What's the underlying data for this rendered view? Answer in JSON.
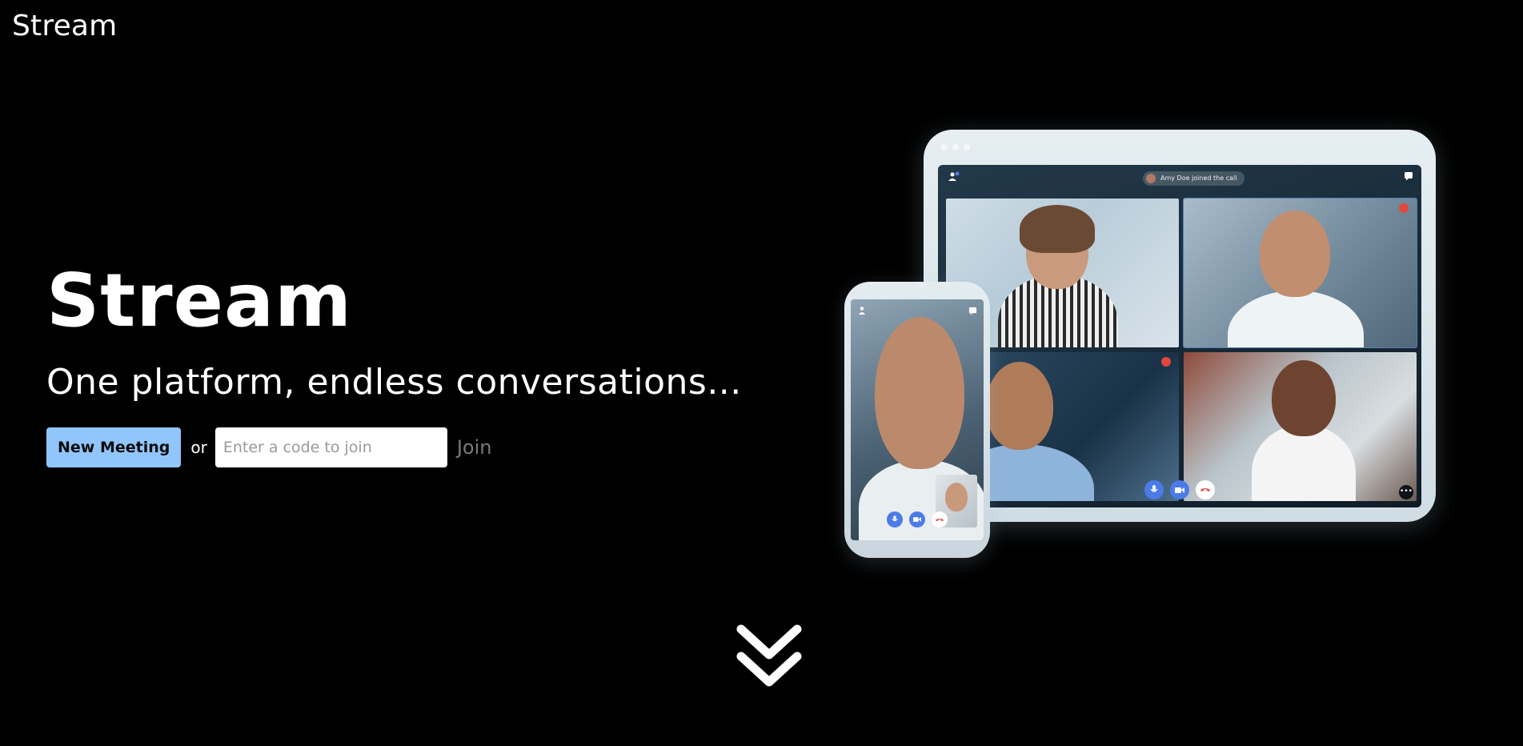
{
  "header": {
    "logo": "Stream"
  },
  "hero": {
    "title": "Stream",
    "subtitle": "One platform, endless conversations...",
    "new_meeting_label": "New Meeting",
    "or_text": "or",
    "code_placeholder": "Enter a code to join",
    "code_value": "",
    "join_label": "Join"
  },
  "illustration": {
    "joined_notice": "Amy Doe joined the call"
  },
  "icons": {
    "scroll": "double-chevron-down-icon",
    "mic": "mic-icon",
    "camera": "video-icon",
    "hangup": "phone-hangup-icon",
    "more": "more-icon"
  },
  "colors": {
    "background": "#000000",
    "primary_button": "#90c6fb",
    "join_text": "#7a7a7a",
    "call_accent": "#4c7be8",
    "hangup": "#e2483d"
  }
}
